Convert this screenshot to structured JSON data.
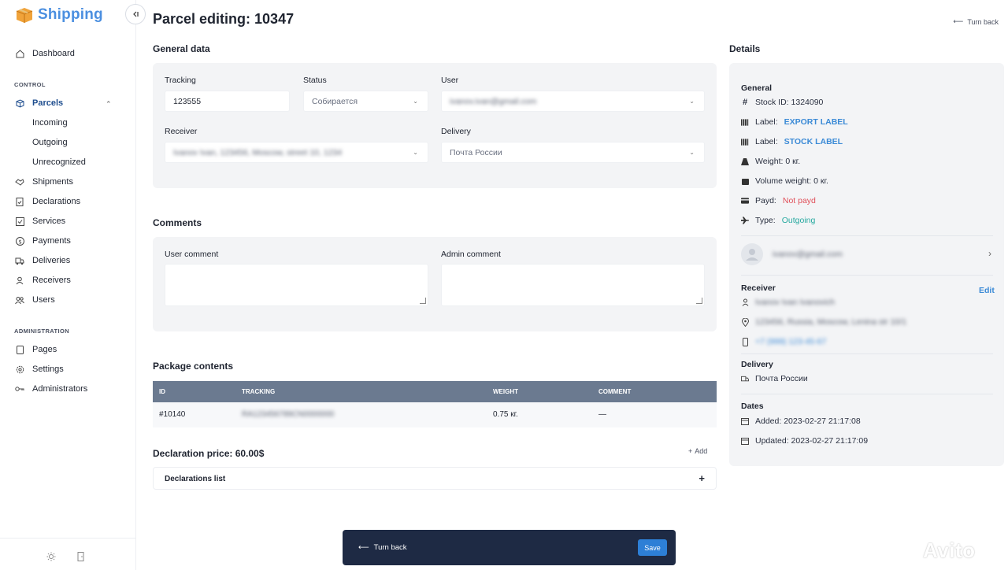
{
  "app": {
    "name": "Shipping"
  },
  "sidebar": {
    "main_items": [
      {
        "label": "Dashboard",
        "icon": "home-icon"
      }
    ],
    "control_section": "CONTROL",
    "parcels": {
      "label": "Parcels",
      "icon": "box-icon",
      "expanded": true
    },
    "parcels_sub": [
      "Incoming",
      "Outgoing",
      "Unrecognized"
    ],
    "control_items": [
      {
        "label": "Shipments",
        "icon": "handshake-icon"
      },
      {
        "label": "Declarations",
        "icon": "document-icon"
      },
      {
        "label": "Services",
        "icon": "check-square-icon"
      },
      {
        "label": "Payments",
        "icon": "dollar-circle-icon"
      },
      {
        "label": "Deliveries",
        "icon": "truck-icon"
      },
      {
        "label": "Receivers",
        "icon": "person-icon"
      },
      {
        "label": "Users",
        "icon": "users-icon"
      }
    ],
    "admin_section": "ADMINISTRATION",
    "admin_items": [
      {
        "label": "Pages",
        "icon": "page-icon"
      },
      {
        "label": "Settings",
        "icon": "gear-icon"
      },
      {
        "label": "Administrators",
        "icon": "key-icon"
      }
    ]
  },
  "page": {
    "title": "Parcel editing: 10347",
    "turn_back": "Turn back"
  },
  "general": {
    "title": "General data",
    "tracking_label": "Tracking",
    "tracking_value": "123555",
    "status_label": "Status",
    "status_value": "Собирается",
    "user_label": "User",
    "user_value": "ivanov.ivan@gmail.com",
    "receiver_label": "Receiver",
    "receiver_value": "Ivanov Ivan, 123456, Moscow, street 10, 1234",
    "delivery_label": "Delivery",
    "delivery_value": "Почта России"
  },
  "comments": {
    "title": "Comments",
    "user_label": "User comment",
    "admin_label": "Admin comment"
  },
  "package": {
    "title": "Package contents",
    "columns": [
      "ID",
      "TRACKING",
      "WEIGHT",
      "COMMENT"
    ],
    "rows": [
      {
        "id": "#10140",
        "tracking": "RA123456789CN0000000",
        "weight": "0.75 кг.",
        "comment": "—"
      }
    ]
  },
  "declaration": {
    "price": "Declaration price: 60.00$",
    "add": "Add",
    "list_label": "Declarations list",
    "plus": "+"
  },
  "details": {
    "title": "Details",
    "general_head": "General",
    "stock_id": "Stock ID: 1324090",
    "label_prefix": "Label:",
    "export_label": "EXPORT LABEL",
    "stock_label": "STOCK LABEL",
    "weight": "Weight: 0 кг.",
    "volume_weight": "Volume weight: 0 кг.",
    "payd_prefix": "Payd:",
    "payd_value": "Not payd",
    "type_prefix": "Type:",
    "type_value": "Outgoing",
    "user_email": "ivanov@gmail.com",
    "receiver_head": "Receiver",
    "edit": "Edit",
    "receiver_name": "Ivanov Ivan Ivanovich",
    "receiver_address": "123456, Russia, Moscow, Lenina str 10/1",
    "receiver_phone": "+7 (999) 123-45-67",
    "delivery_head": "Delivery",
    "delivery_value": "Почта России",
    "dates_head": "Dates",
    "added": "Added: 2023-02-27 21:17:08",
    "updated": "Updated: 2023-02-27 21:17:09"
  },
  "bottom_bar": {
    "turn_back": "Turn back",
    "save": "Save"
  },
  "watermark": "Avito",
  "colors": {
    "accent": "#3b8ad6",
    "bar": "#1e2a44",
    "header": "#6b7a90",
    "danger": "#e0505a",
    "teal": "#27a9a0"
  }
}
